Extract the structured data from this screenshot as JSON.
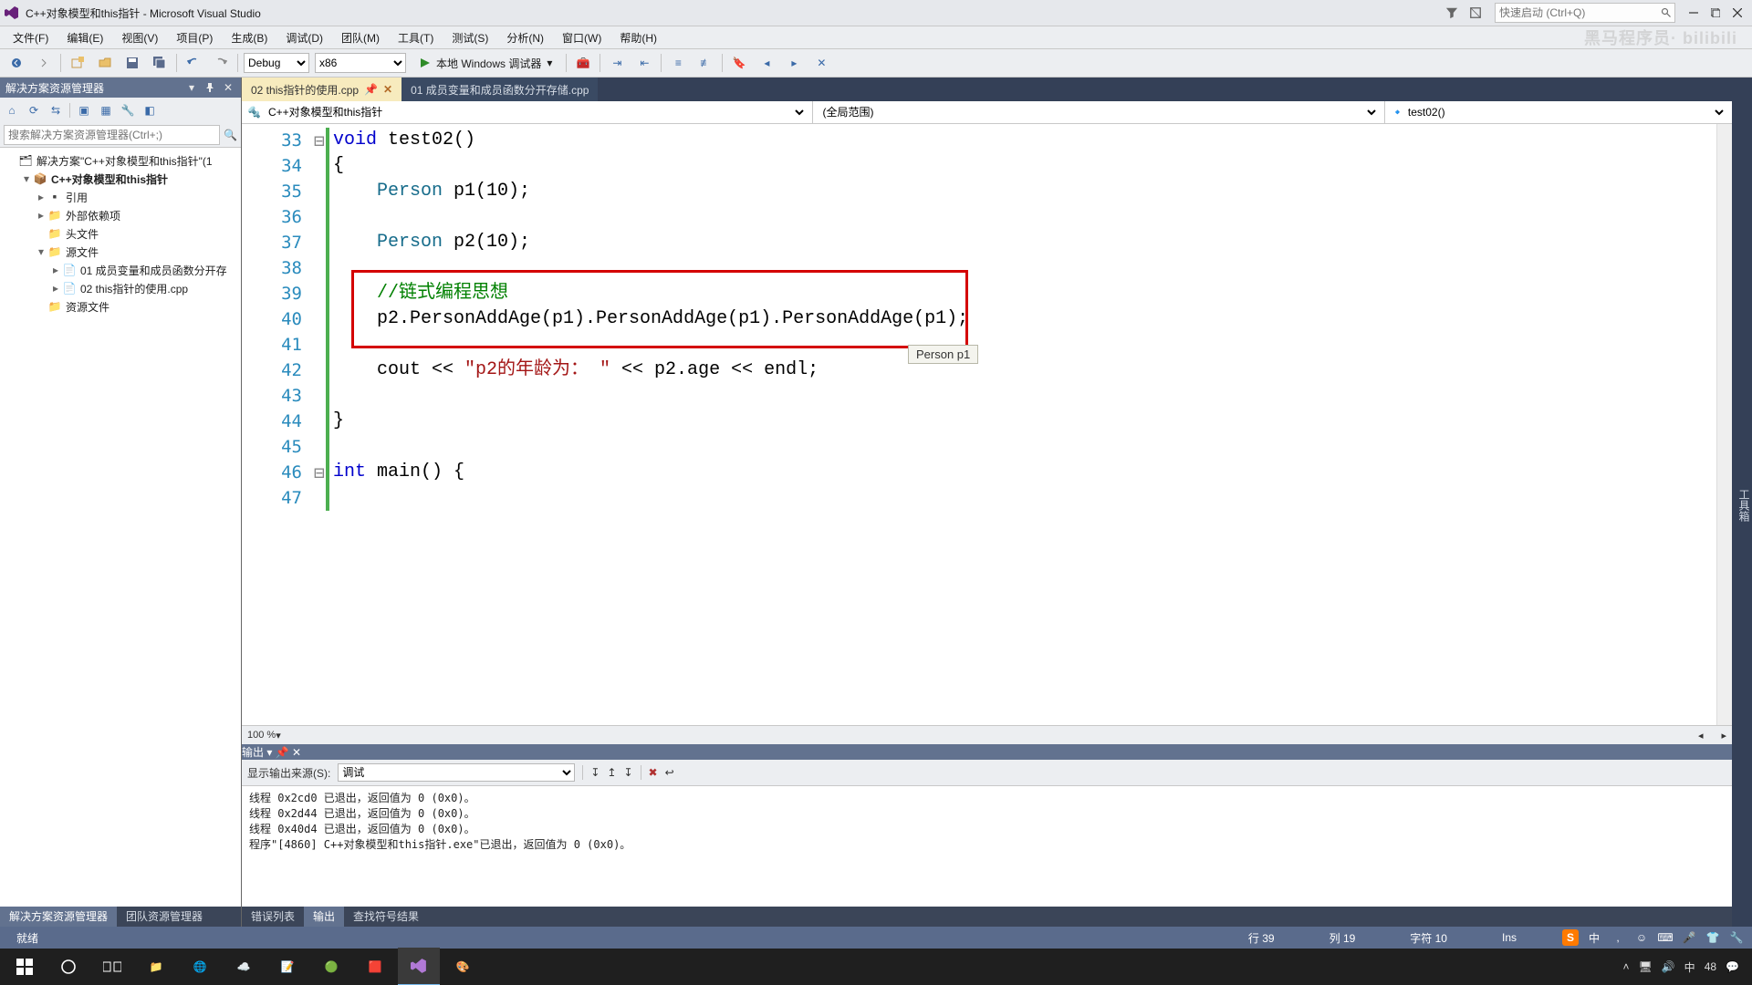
{
  "colors": {
    "accent": "#62728f",
    "status_bg": "#5a6b8c",
    "highlight_box": "#d40000",
    "comment": "#008000",
    "keyword": "#0000cc",
    "string": "#a31515"
  },
  "title": "C++对象模型和this指针 - Microsoft Visual Studio",
  "quick_launch_placeholder": "快速启动 (Ctrl+Q)",
  "menu": [
    "文件(F)",
    "编辑(E)",
    "视图(V)",
    "项目(P)",
    "生成(B)",
    "调试(D)",
    "团队(M)",
    "工具(T)",
    "测试(S)",
    "分析(N)",
    "窗口(W)",
    "帮助(H)"
  ],
  "watermark": "黑马程序员· bilibili",
  "toolbar": {
    "config": "Debug",
    "platform": "x86",
    "run_label": "本地 Windows 调试器"
  },
  "solution_panel": {
    "title": "解决方案资源管理器",
    "search_placeholder": "搜索解决方案资源管理器(Ctrl+;)"
  },
  "solution_tree": {
    "solution": "解决方案\"C++对象模型和this指针\"(1",
    "project": "C++对象模型和this指针",
    "refs": "引用",
    "ext": "外部依赖项",
    "headers": "头文件",
    "sources": "源文件",
    "src1": "01 成员变量和成员函数分开存",
    "src2": "02 this指针的使用.cpp",
    "resources": "资源文件"
  },
  "solution_bottom_tabs": [
    "解决方案资源管理器",
    "团队资源管理器"
  ],
  "editor": {
    "tabs": [
      {
        "label": "02 this指针的使用.cpp",
        "active": true
      },
      {
        "label": "01 成员变量和成员函数分开存储.cpp",
        "active": false
      }
    ],
    "nav": {
      "scope": "C++对象模型和this指针",
      "class": "(全局范围)",
      "member": "test02()"
    },
    "zoom": "100 %",
    "tooltip": "Person p1"
  },
  "code": {
    "l33a": "void",
    "l33b": " test02()",
    "l34": "{",
    "l35a": "    ",
    "l35b": "Person",
    "l35c": " p1(10);",
    "l37a": "    ",
    "l37b": "Person",
    "l37c": " p2(10);",
    "l39": "    //链式编程思想",
    "l40": "    p2.PersonAddAge(p1).PersonAddAge(p1).PersonAddAge(p1);",
    "l42a": "    cout << ",
    "l42b": "\"p2的年龄为： \"",
    "l42c": " << p2.age << endl;",
    "l44": "}",
    "l46a": "int",
    "l46b": " main() {"
  },
  "line_numbers": [
    "33",
    "34",
    "35",
    "36",
    "37",
    "38",
    "39",
    "40",
    "41",
    "42",
    "43",
    "44",
    "45",
    "46",
    "47"
  ],
  "output": {
    "title": "输出",
    "source_label": "显示输出来源(S):",
    "source_value": "调试",
    "body": "线程 0x2cd0 已退出，返回值为 0 (0x0)。\n线程 0x2d44 已退出，返回值为 0 (0x0)。\n线程 0x40d4 已退出，返回值为 0 (0x0)。\n程序\"[4860] C++对象模型和this指针.exe\"已退出，返回值为 0 (0x0)。",
    "tabs": [
      "错误列表",
      "输出",
      "查找符号结果"
    ]
  },
  "status": {
    "ready": "就绪",
    "line": "行 39",
    "col": "列 19",
    "char": "字符 10",
    "ins": "Ins"
  },
  "taskbar": {
    "time": "48",
    "chinese_ime": "中"
  }
}
